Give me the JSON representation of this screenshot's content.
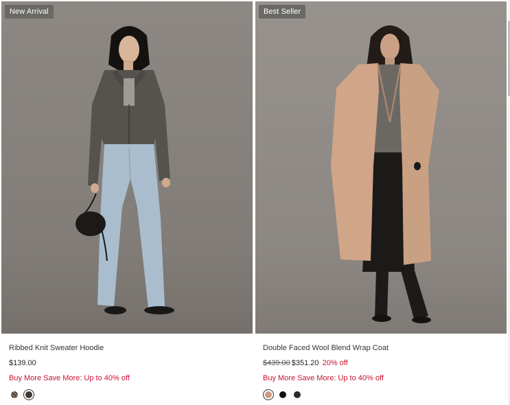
{
  "products": [
    {
      "badge": "New Arrival",
      "title": "Ribbed Knit Sweater Hoodie",
      "price": "$139.00",
      "original_price": "",
      "discount": "",
      "promo": "Buy More Save More: Up to 40% off",
      "swatches": [
        {
          "color": "#6b5a4c",
          "pattern": "tweed",
          "selected": false
        },
        {
          "color": "#3d3b38",
          "selected": true
        }
      ]
    },
    {
      "badge": "Best Seller",
      "title": "Double Faced Wool Blend Wrap Coat",
      "price": "$351.20",
      "original_price": "$439.00",
      "discount": "20% off",
      "promo": "Buy More Save More: Up to 40% off",
      "swatches": [
        {
          "color": "#c99a82",
          "selected": true
        },
        {
          "color": "#111111",
          "selected": false
        },
        {
          "color": "#2a2a2a",
          "selected": false
        }
      ]
    }
  ],
  "colors": {
    "badge_bg": "#6a6966",
    "sale_red": "#c8102e",
    "photo_bg": "#8a8580"
  }
}
